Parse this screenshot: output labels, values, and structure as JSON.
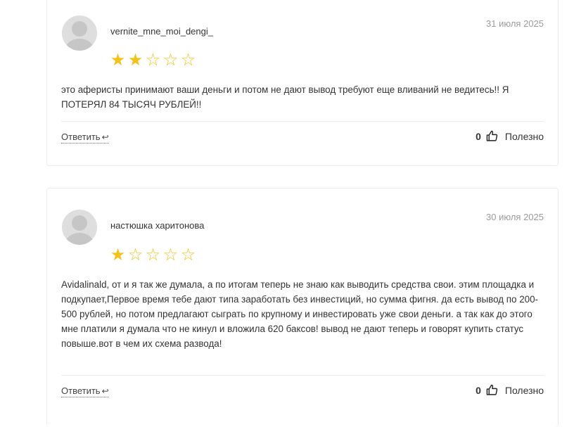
{
  "reviews": [
    {
      "author": "vernite_mne_moi_dengi_",
      "date": "31 июля 2025",
      "rating": 2,
      "rating_max": 5,
      "text": "это аферисты принимают ваши деньги и потом не дают вывод требуют еще вливаний не ведитесь!! Я ПОТЕРЯЛ 84 ТЫСЯЧ РУБЛЕЙ!!",
      "reply_label": "Ответить",
      "helpful_count": "0",
      "helpful_label": "Полезно"
    },
    {
      "author": "настюшка харитонова",
      "date": "30 июля 2025",
      "rating": 1,
      "rating_max": 5,
      "text": "Avidalinald, от и я так же думала, а по итогам теперь не знаю как выводить средства свои. этим площадка и подкупает,Первое время тебе дают типа заработать без инвестиций, но сумма фигня. да есть вывод по 200-500 рублей, но потом предлагают сыграть по крупному и инвестировать уже свои деньги. а так как до этого мне платили я думала что не кинул и вложила 620 баксов! вывод не дают теперь и говорят купить статус повыше.вот в чем их схема развода!",
      "reply_label": "Ответить",
      "helpful_count": "0",
      "helpful_label": "Полезно"
    }
  ],
  "icons": {
    "reply": "reply-arrow-icon",
    "helpful": "thumbs-up-icon",
    "star_filled": "star-filled-icon",
    "star_empty": "star-outline-icon"
  },
  "colors": {
    "star": "#f2c21a",
    "date": "#9a9a9a"
  }
}
